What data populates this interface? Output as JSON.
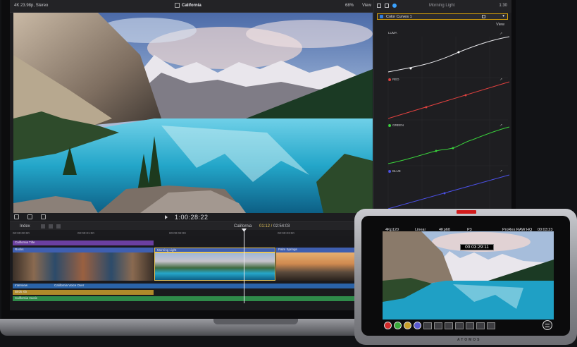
{
  "viewer": {
    "format_info": "4K 23.98p, Stereo",
    "project_title": "California",
    "zoom": "68%",
    "view_label": "View",
    "timecode": "1:00:28:22"
  },
  "inspector": {
    "clip_name": "Morning Light",
    "timecode": "1:30",
    "effect_name": "Color Curves 1",
    "view_label": "View",
    "curves": [
      {
        "name": "LUMA",
        "color": "#e8e8ec"
      },
      {
        "name": "RED",
        "color": "#e0413f"
      },
      {
        "name": "GREEN",
        "color": "#3ad23c"
      },
      {
        "name": "BLUE",
        "color": "#4b50e6"
      }
    ]
  },
  "timeline": {
    "index_label": "Index",
    "project_name": "California",
    "position": "01:12",
    "duration": "02:54:03",
    "ruler_ticks": [
      "00:00:00:00",
      "00:00:01:00",
      "00:00:02:00",
      "00:00:03:00",
      "00:00:04:00"
    ],
    "tracks": {
      "title_clip": "California Title",
      "broll_clip": "Rocks",
      "selected_clip": "Morning Light",
      "third_clip": "Palm Springs",
      "audio1": "Interview",
      "audio1b": "California Voice Over",
      "audio2": "Birds sfx",
      "audio3": "California music"
    }
  },
  "atomos": {
    "status": {
      "res": "4Kp120",
      "gamma": "Linear",
      "ratio": "4Kp60",
      "p_label": "P3",
      "codec": "ProRes RAW HQ",
      "tc_small": "00:03:23"
    },
    "timecode": "00:03:29:11",
    "brand": "ATOMOS",
    "colors": {
      "body": "#9a9ba0",
      "rec": "#d21c1c"
    }
  }
}
